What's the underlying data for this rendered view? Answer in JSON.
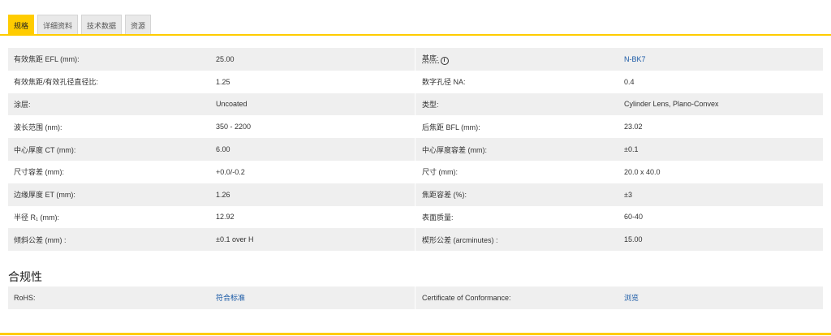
{
  "tabs": [
    {
      "label": "规格",
      "active": true
    },
    {
      "label": "详细资料",
      "active": false
    },
    {
      "label": "技术数据",
      "active": false
    },
    {
      "label": "资源",
      "active": false
    }
  ],
  "specs": [
    {
      "l1": "有效焦距 EFL (mm):",
      "v1": "25.00",
      "l2": "基底:",
      "v2": "N-BK7",
      "v2_link": true,
      "l2_info": true
    },
    {
      "l1": "有效焦距/有效孔径直径比:",
      "v1": "1.25",
      "l2": "数字孔径 NA:",
      "v2": "0.4"
    },
    {
      "l1": "涂层:",
      "v1": "Uncoated",
      "l2": "类型:",
      "v2": "Cylinder Lens, Plano-Convex"
    },
    {
      "l1": "波长范围 (nm):",
      "v1": "350 - 2200",
      "l2": "后焦距 BFL (mm):",
      "v2": "23.02"
    },
    {
      "l1": "中心厚度 CT (mm):",
      "v1": "6.00",
      "l2": "中心厚度容差 (mm):",
      "v2": "±0.1"
    },
    {
      "l1": "尺寸容差 (mm):",
      "v1": "+0.0/-0.2",
      "l2": "尺寸 (mm):",
      "v2": "20.0 x 40.0"
    },
    {
      "l1": "边缘厚度 ET (mm):",
      "v1": "1.26",
      "l2": "焦距容差 (%):",
      "v2": "±3"
    },
    {
      "l1": "半径 R₁ (mm):",
      "v1": "12.92",
      "l2": "表面质量:",
      "v2": "60-40"
    },
    {
      "l1": "倾斜公差 (mm) :",
      "v1": "±0.1 over H",
      "l2": "楔形公差 (arcminutes) :",
      "v2": "15.00"
    }
  ],
  "compliance": {
    "title": "合规性",
    "rows": [
      {
        "l1": "RoHS:",
        "v1": "符合标准",
        "l2": "Certificate of Conformance:",
        "v2": "浏览"
      }
    ]
  },
  "colors": {
    "accent": "#ffcc00",
    "link": "#1a5aa6",
    "row_shade": "#efefef"
  }
}
